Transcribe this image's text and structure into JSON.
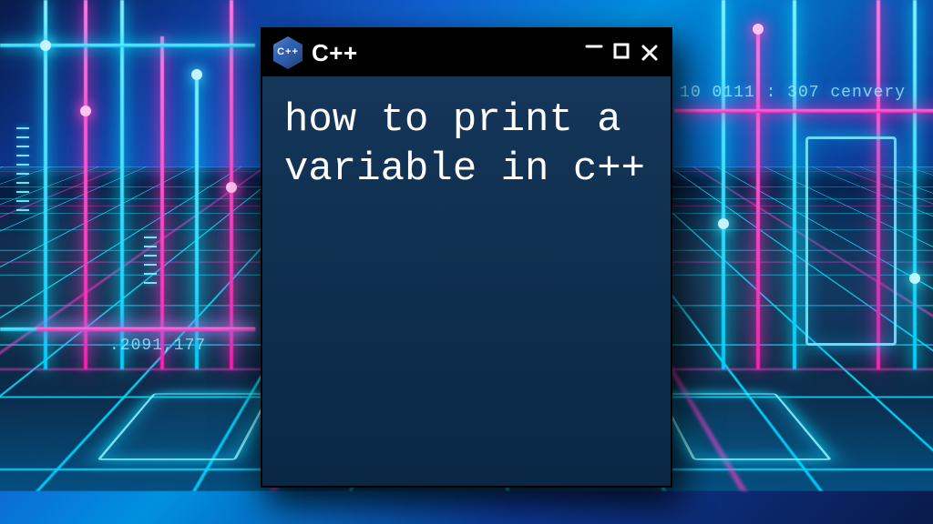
{
  "window": {
    "title": "C++",
    "logo_letters": "++",
    "controls": {
      "minimize_glyph": "—",
      "maximize_glyph": "▢",
      "close_glyph": "✕"
    }
  },
  "content": {
    "text": "how to print a variable in c++"
  },
  "background": {
    "text_top_right": "10 0111 : 307  cenvery",
    "text_mid_left": ".2091,177"
  },
  "colors": {
    "console_bg": "#0b2e52",
    "titlebar_bg": "#000000",
    "neon_cyan": "#00e0ff",
    "neon_pink": "#ff30c0"
  }
}
